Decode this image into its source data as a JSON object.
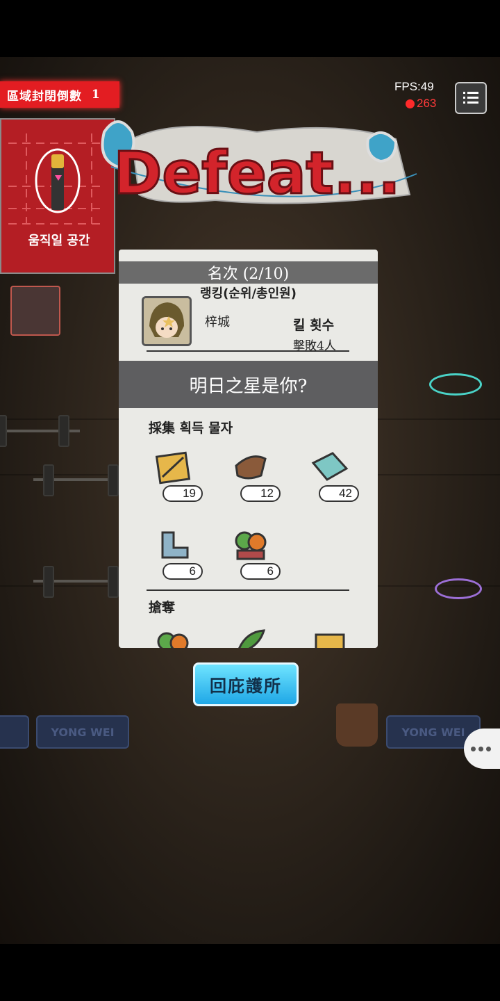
{
  "hud": {
    "countdown_label": "區域封閉倒數",
    "countdown_value": "1",
    "fps": "FPS:49",
    "ping": "263",
    "menu_icon": "list-icon"
  },
  "minimap": {
    "label": "움직일 공간"
  },
  "result": {
    "title": "Defeat..."
  },
  "panel": {
    "header": "名次 (2/10)",
    "rank_label": "랭킹(순위/총인원)",
    "player_name": "梓城",
    "kill_label": "킬 횟수",
    "kill_value": "擊敗4人",
    "banner": "明日之星是你?",
    "gathered_title": "採集 획득 물자",
    "gathered_items": [
      {
        "icon": "crate-icon",
        "count": "19"
      },
      {
        "icon": "leather-icon",
        "count": "12"
      },
      {
        "icon": "cloth-icon",
        "count": "42"
      },
      {
        "icon": "pipe-icon",
        "count": "6"
      },
      {
        "icon": "food-icon",
        "count": "6"
      }
    ],
    "looted_title": "搶奪",
    "looted_items": [
      {
        "icon": "food-icon"
      },
      {
        "icon": "herb-icon"
      },
      {
        "icon": "crate-icon"
      }
    ]
  },
  "buttons": {
    "return": "回庇護所"
  },
  "scenery": {
    "bench_text": "YONG WEI"
  },
  "colors": {
    "countdown_red": "#e31d22",
    "return_blue": "#1fa7e6"
  }
}
